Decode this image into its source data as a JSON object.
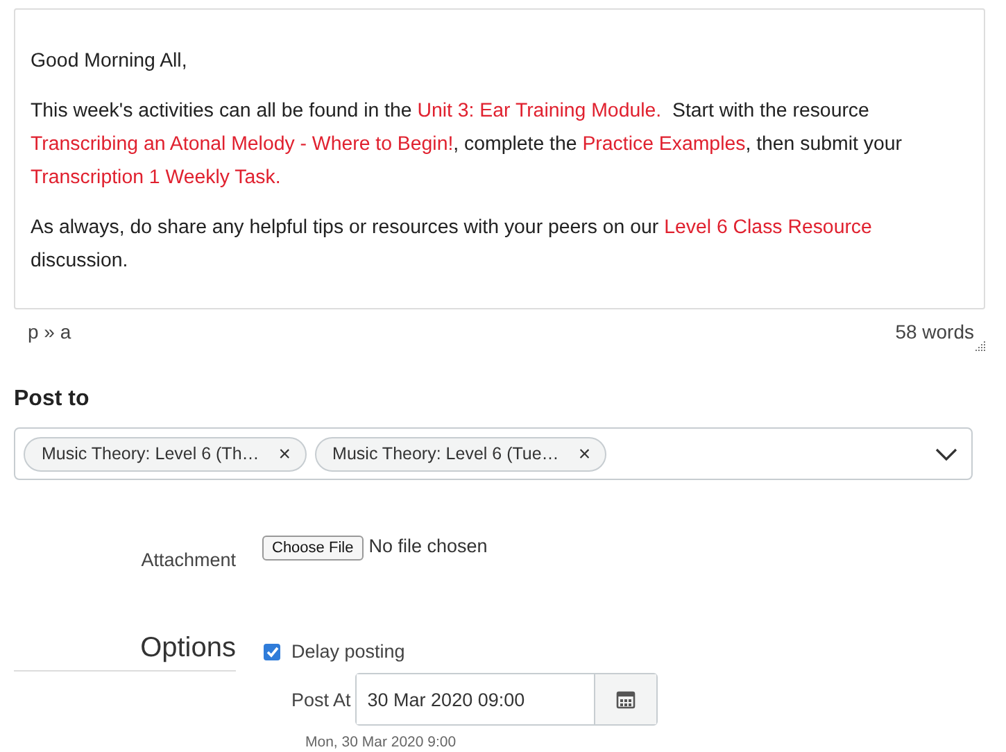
{
  "editor": {
    "paragraphs": [
      [
        {
          "kind": "text",
          "text": "Good Morning All,"
        }
      ],
      [
        {
          "kind": "text",
          "text": "This week's activities can all be found in the "
        },
        {
          "kind": "link",
          "text": "Unit 3: Ear Training Module."
        },
        {
          "kind": "text",
          "text": "  Start with the resource "
        },
        {
          "kind": "link",
          "text": "Transcribing an Atonal Melody - Where to Begin!"
        },
        {
          "kind": "text",
          "text": ", complete the "
        },
        {
          "kind": "link",
          "text": "Practice Examples"
        },
        {
          "kind": "text",
          "text": ", then submit your "
        },
        {
          "kind": "link",
          "text": "Transcription 1 Weekly Task."
        }
      ],
      [
        {
          "kind": "text",
          "text": "As always, do share any helpful tips or resources with your peers on our "
        },
        {
          "kind": "link",
          "text": "Level 6 Class Resource"
        },
        {
          "kind": "text",
          "text": " discussion."
        }
      ]
    ],
    "path": "p » a",
    "word_count": "58 words"
  },
  "post_to": {
    "label": "Post to",
    "tags": [
      "Music Theory: Level 6 (Th…",
      "Music Theory: Level 6 (Tue…"
    ],
    "remove": "×"
  },
  "attachment": {
    "label": "Attachment",
    "button": "Choose File",
    "status": "No file chosen"
  },
  "options": {
    "heading": "Options",
    "delay": {
      "label": "Delay posting",
      "checked": true
    },
    "post_at": {
      "label": "Post At",
      "value": "30 Mar 2020 09:00",
      "hint": "Mon, 30 Mar 2020 9:00"
    }
  }
}
